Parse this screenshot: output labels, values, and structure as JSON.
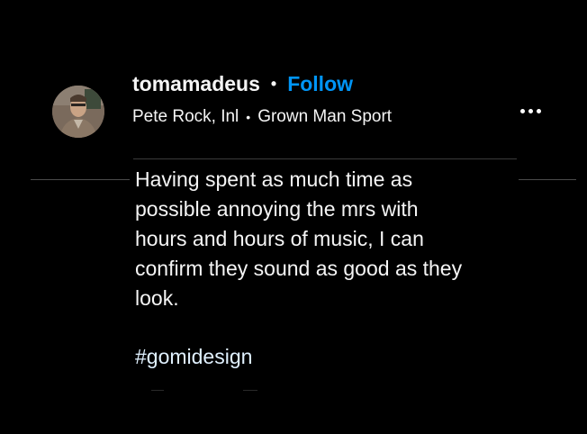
{
  "post": {
    "username": "tomamadeus",
    "separator": "•",
    "follow_label": "Follow",
    "audio": {
      "artist": "Pete Rock, Inl",
      "separator": "•",
      "track": "Grown Man Sport"
    },
    "more_icon": "more-options-icon",
    "caption_lines": [
      "Having spent as much time as",
      "possible annoying the mrs with",
      "hours and hours of music, I can",
      "confirm they sound as good as they",
      "look."
    ],
    "hashtag": "#gomidesign"
  },
  "colors": {
    "background": "#000000",
    "text": "#f5f5f5",
    "follow": "#0095f6",
    "hashtag": "#e0f1ff",
    "divider": "#3a3a3a"
  }
}
